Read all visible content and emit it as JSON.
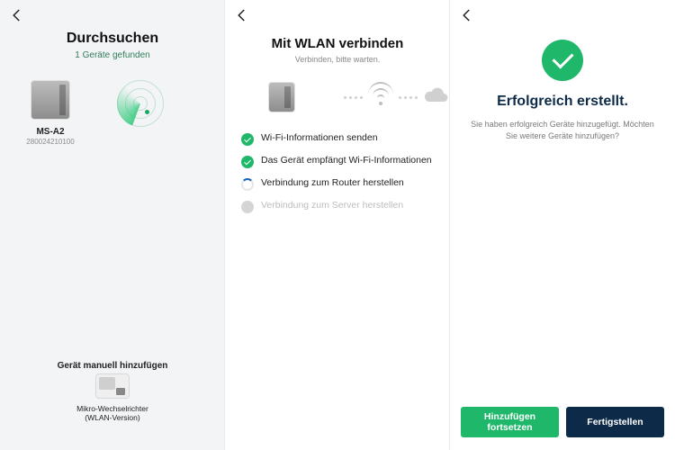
{
  "colors": {
    "accent_green": "#1fb76a",
    "accent_navy": "#0d2b49"
  },
  "panel1": {
    "title": "Durchsuchen",
    "found_label": "1 Geräte gefunden",
    "devices": [
      {
        "name": "MS-A2",
        "serial": "280024210100",
        "icon": "battery-storage-icon"
      }
    ],
    "scanning_icon": "radar-icon",
    "manual_add_title": "Gerät manuell hinzufügen",
    "manual_items": [
      {
        "label_line1": "Mikro-Wechselrichter",
        "label_line2": "(WLAN-Version)",
        "icon": "micro-inverter-icon"
      }
    ]
  },
  "panel2": {
    "title": "Mit WLAN verbinden",
    "subtitle": "Verbinden, bitte warten.",
    "flow_icons": [
      "device-icon",
      "wifi-icon",
      "cloud-icon"
    ],
    "steps": [
      {
        "state": "done",
        "text": "Wi-Fi-Informationen senden"
      },
      {
        "state": "done",
        "text": "Das Gerät empfängt Wi-Fi-Informationen"
      },
      {
        "state": "progress",
        "text": "Verbindung zum Router herstellen"
      },
      {
        "state": "todo",
        "text": "Verbindung zum Server herstellen"
      }
    ]
  },
  "panel3": {
    "title": "Erfolgreich erstellt.",
    "message": "Sie haben erfolgreich Geräte hinzugefügt. Möchten Sie weitere Geräte hinzufügen?",
    "btn_continue": "Hinzufügen fortsetzen",
    "btn_finish": "Fertigstellen"
  }
}
